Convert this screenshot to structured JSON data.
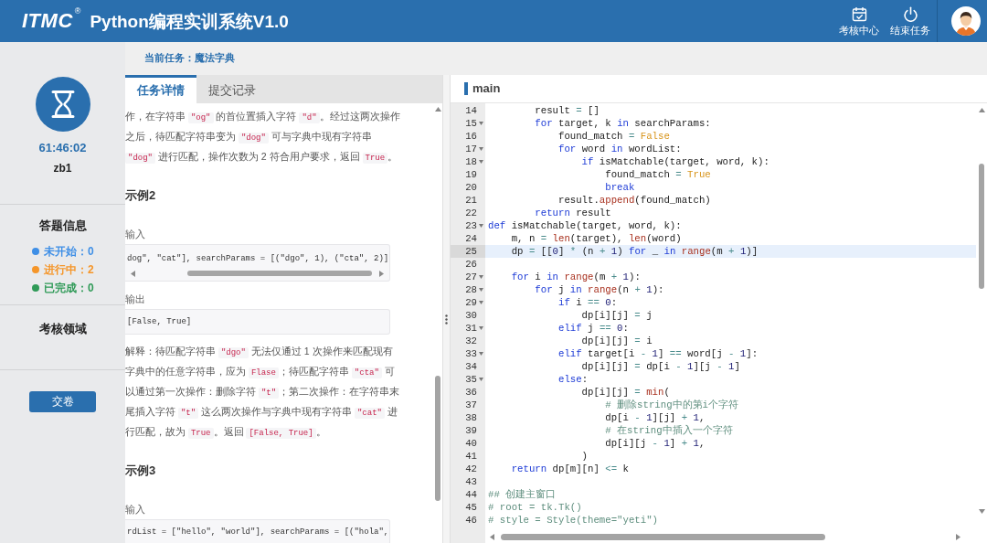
{
  "header": {
    "logo": "ITMC",
    "logo_mark": "®",
    "title": "Python编程实训系统V1.0",
    "actions": [
      {
        "kind": "calendar",
        "label": "考核中心"
      },
      {
        "kind": "power",
        "label": "结束任务"
      }
    ]
  },
  "sidebar": {
    "timer": "61:46:02",
    "user": "zb1",
    "info_title": "答题信息",
    "statuses": [
      {
        "text": "未开始：0",
        "color": "#3f8fe6"
      },
      {
        "text": "进行中：2",
        "color": "#f5962a"
      },
      {
        "text": "已完成：0",
        "color": "#2f9a57"
      }
    ],
    "domain_title": "考核领域",
    "submit_button": "交卷"
  },
  "task_bar": {
    "text": "当前任务：魔法字典"
  },
  "task_panel": {
    "tabs": [
      {
        "label": "任务详情",
        "selected": true
      },
      {
        "label": "提交记录",
        "selected": false
      }
    ],
    "content": [
      {
        "kind": "paragraph",
        "lines": [
          [
            {
              "kind": "text",
              "text": "作，在字符串 "
            },
            {
              "kind": "code",
              "text": "\"og\""
            },
            {
              "kind": "text",
              "text": " 的首位置插入字符 "
            },
            {
              "kind": "code",
              "text": "\"d\""
            },
            {
              "kind": "text",
              "text": "。经过这两次操作"
            }
          ],
          [
            {
              "kind": "text",
              "text": "之后，待匹配字符串变为 "
            },
            {
              "kind": "code",
              "text": "\"dog\""
            },
            {
              "kind": "text",
              "text": " 可与字典中现有字符串"
            }
          ],
          [
            {
              "kind": "code",
              "text": "\"dog\""
            },
            {
              "kind": "text",
              "text": " 进行匹配，操作次数为 2 符合用户要求，返回 "
            },
            {
              "kind": "code",
              "text": "True"
            },
            {
              "kind": "text",
              "text": "。"
            }
          ]
        ]
      },
      {
        "kind": "heading",
        "text": "示例2"
      },
      {
        "kind": "label",
        "text": "输入"
      },
      {
        "kind": "code",
        "text": "dog\", \"cat\"], searchParams = [(\"dgo\", 1), (\"cta\", 2)]",
        "scrollbar": true
      },
      {
        "kind": "label",
        "text": "输出"
      },
      {
        "kind": "code",
        "text": "[False, True]",
        "scrollbar": false
      },
      {
        "kind": "paragraph",
        "lines": [
          [
            {
              "kind": "text",
              "text": "解释：待匹配字符串 "
            },
            {
              "kind": "code",
              "text": "\"dgo\""
            },
            {
              "kind": "text",
              "text": " 无法仅通过 1 次操作来匹配现有"
            }
          ],
          [
            {
              "kind": "text",
              "text": "字典中的任意字符串，应为 "
            },
            {
              "kind": "code",
              "text": "Flase"
            },
            {
              "kind": "text",
              "text": "；待匹配字符串 "
            },
            {
              "kind": "code",
              "text": "\"cta\""
            },
            {
              "kind": "text",
              "text": " 可"
            }
          ],
          [
            {
              "kind": "text",
              "text": "以通过第一次操作：删除字符 "
            },
            {
              "kind": "code",
              "text": "\"t\""
            },
            {
              "kind": "text",
              "text": "；第二次操作：在字符串末"
            }
          ],
          [
            {
              "kind": "text",
              "text": "尾插入字符 "
            },
            {
              "kind": "code",
              "text": "\"t\""
            },
            {
              "kind": "text",
              "text": " 这么两次操作与字典中现有字符串 "
            },
            {
              "kind": "code",
              "text": "\"cat\""
            },
            {
              "kind": "text",
              "text": " 进"
            }
          ],
          [
            {
              "kind": "text",
              "text": "行匹配，故为 "
            },
            {
              "kind": "code",
              "text": "True"
            },
            {
              "kind": "text",
              "text": "。返回 "
            },
            {
              "kind": "code",
              "text": "[False, True]"
            },
            {
              "kind": "text",
              "text": "。"
            }
          ]
        ]
      },
      {
        "kind": "heading",
        "text": "示例3"
      },
      {
        "kind": "label",
        "text": "输入"
      },
      {
        "kind": "code",
        "text": "rdList = [\"hello\", \"world\"], searchParams = [(\"hola\",",
        "scrollbar": false
      }
    ]
  },
  "editor": {
    "file": "main",
    "lines": [
      {
        "number": "14",
        "foldable": false,
        "active": false,
        "tokens": [
          {
            "kind": "plain",
            "text": "        result "
          },
          {
            "kind": "operator",
            "text": "="
          },
          {
            "kind": "plain",
            "text": " []"
          }
        ]
      },
      {
        "number": "15",
        "foldable": true,
        "active": false,
        "tokens": [
          {
            "kind": "keyword",
            "text": "        for"
          },
          {
            "kind": "plain",
            "text": " target, k "
          },
          {
            "kind": "keyword",
            "text": "in"
          },
          {
            "kind": "plain",
            "text": " searchParams:"
          }
        ]
      },
      {
        "number": "16",
        "foldable": false,
        "active": false,
        "tokens": [
          {
            "kind": "plain",
            "text": "            found_match "
          },
          {
            "kind": "operator",
            "text": "="
          },
          {
            "kind": "constant",
            "text": " False"
          }
        ]
      },
      {
        "number": "17",
        "foldable": true,
        "active": false,
        "tokens": [
          {
            "kind": "keyword",
            "text": "            for"
          },
          {
            "kind": "plain",
            "text": " word "
          },
          {
            "kind": "keyword",
            "text": "in"
          },
          {
            "kind": "plain",
            "text": " wordList:"
          }
        ]
      },
      {
        "number": "18",
        "foldable": true,
        "active": false,
        "tokens": [
          {
            "kind": "keyword",
            "text": "                if"
          },
          {
            "kind": "plain",
            "text": " isMatchable(target, word, k):"
          }
        ]
      },
      {
        "number": "19",
        "foldable": false,
        "active": false,
        "tokens": [
          {
            "kind": "plain",
            "text": "                    found_match "
          },
          {
            "kind": "operator",
            "text": "="
          },
          {
            "kind": "constant",
            "text": " True"
          }
        ]
      },
      {
        "number": "20",
        "foldable": false,
        "active": false,
        "tokens": [
          {
            "kind": "keyword",
            "text": "                    break"
          }
        ]
      },
      {
        "number": "21",
        "foldable": false,
        "active": false,
        "tokens": [
          {
            "kind": "plain",
            "text": "            result."
          },
          {
            "kind": "builtin",
            "text": "append"
          },
          {
            "kind": "plain",
            "text": "(found_match)"
          }
        ]
      },
      {
        "number": "22",
        "foldable": false,
        "active": false,
        "tokens": [
          {
            "kind": "keyword",
            "text": "        return"
          },
          {
            "kind": "plain",
            "text": " result"
          }
        ]
      },
      {
        "number": "23",
        "foldable": true,
        "active": false,
        "tokens": [
          {
            "kind": "keyword",
            "text": "def"
          },
          {
            "kind": "plain",
            "text": " isMatchable(target, word, k):"
          }
        ]
      },
      {
        "number": "24",
        "foldable": false,
        "active": false,
        "tokens": [
          {
            "kind": "plain",
            "text": "    m, n "
          },
          {
            "kind": "operator",
            "text": "="
          },
          {
            "kind": "builtin",
            "text": " len"
          },
          {
            "kind": "plain",
            "text": "(target), "
          },
          {
            "kind": "builtin",
            "text": "len"
          },
          {
            "kind": "plain",
            "text": "(word)"
          }
        ]
      },
      {
        "number": "25",
        "foldable": false,
        "active": true,
        "tokens": [
          {
            "kind": "plain",
            "text": "    dp "
          },
          {
            "kind": "operator",
            "text": "="
          },
          {
            "kind": "plain",
            "text": " [["
          },
          {
            "kind": "number",
            "text": "0"
          },
          {
            "kind": "plain",
            "text": "] "
          },
          {
            "kind": "operator",
            "text": "*"
          },
          {
            "kind": "plain",
            "text": " (n "
          },
          {
            "kind": "operator",
            "text": "+"
          },
          {
            "kind": "number",
            "text": " 1"
          },
          {
            "kind": "plain",
            "text": ") "
          },
          {
            "kind": "keyword",
            "text": "for"
          },
          {
            "kind": "plain",
            "text": " _ "
          },
          {
            "kind": "keyword",
            "text": "in"
          },
          {
            "kind": "builtin",
            "text": " range"
          },
          {
            "kind": "plain",
            "text": "(m "
          },
          {
            "kind": "operator",
            "text": "+"
          },
          {
            "kind": "number",
            "text": " 1"
          },
          {
            "kind": "plain",
            "text": ")]"
          }
        ]
      },
      {
        "number": "26",
        "foldable": false,
        "active": false
      },
      {
        "number": "27",
        "foldable": true,
        "active": false,
        "tokens": [
          {
            "kind": "keyword",
            "text": "    for"
          },
          {
            "kind": "plain",
            "text": " i "
          },
          {
            "kind": "keyword",
            "text": "in"
          },
          {
            "kind": "builtin",
            "text": " range"
          },
          {
            "kind": "plain",
            "text": "(m "
          },
          {
            "kind": "operator",
            "text": "+"
          },
          {
            "kind": "number",
            "text": " 1"
          },
          {
            "kind": "plain",
            "text": "):"
          }
        ]
      },
      {
        "number": "28",
        "foldable": true,
        "active": false,
        "tokens": [
          {
            "kind": "keyword",
            "text": "        for"
          },
          {
            "kind": "plain",
            "text": " j "
          },
          {
            "kind": "keyword",
            "text": "in"
          },
          {
            "kind": "builtin",
            "text": " range"
          },
          {
            "kind": "plain",
            "text": "(n "
          },
          {
            "kind": "operator",
            "text": "+"
          },
          {
            "kind": "number",
            "text": " 1"
          },
          {
            "kind": "plain",
            "text": "):"
          }
        ]
      },
      {
        "number": "29",
        "foldable": true,
        "active": false,
        "tokens": [
          {
            "kind": "keyword",
            "text": "            if"
          },
          {
            "kind": "plain",
            "text": " i "
          },
          {
            "kind": "operator",
            "text": "=="
          },
          {
            "kind": "number",
            "text": " 0"
          },
          {
            "kind": "plain",
            "text": ":"
          }
        ]
      },
      {
        "number": "30",
        "foldable": false,
        "active": false,
        "tokens": [
          {
            "kind": "plain",
            "text": "                dp[i][j] "
          },
          {
            "kind": "operator",
            "text": "="
          },
          {
            "kind": "plain",
            "text": " j"
          }
        ]
      },
      {
        "number": "31",
        "foldable": true,
        "active": false,
        "tokens": [
          {
            "kind": "keyword",
            "text": "            elif"
          },
          {
            "kind": "plain",
            "text": " j "
          },
          {
            "kind": "operator",
            "text": "=="
          },
          {
            "kind": "number",
            "text": " 0"
          },
          {
            "kind": "plain",
            "text": ":"
          }
        ]
      },
      {
        "number": "32",
        "foldable": false,
        "active": false,
        "tokens": [
          {
            "kind": "plain",
            "text": "                dp[i][j] "
          },
          {
            "kind": "operator",
            "text": "="
          },
          {
            "kind": "plain",
            "text": " i"
          }
        ]
      },
      {
        "number": "33",
        "foldable": true,
        "active": false,
        "tokens": [
          {
            "kind": "keyword",
            "text": "            elif"
          },
          {
            "kind": "plain",
            "text": " target[i "
          },
          {
            "kind": "operator",
            "text": "-"
          },
          {
            "kind": "number",
            "text": " 1"
          },
          {
            "kind": "plain",
            "text": "] "
          },
          {
            "kind": "operator",
            "text": "=="
          },
          {
            "kind": "plain",
            "text": " word[j "
          },
          {
            "kind": "operator",
            "text": "-"
          },
          {
            "kind": "number",
            "text": " 1"
          },
          {
            "kind": "plain",
            "text": "]:"
          }
        ]
      },
      {
        "number": "34",
        "foldable": false,
        "active": false,
        "tokens": [
          {
            "kind": "plain",
            "text": "                dp[i][j] "
          },
          {
            "kind": "operator",
            "text": "="
          },
          {
            "kind": "plain",
            "text": " dp[i "
          },
          {
            "kind": "operator",
            "text": "-"
          },
          {
            "kind": "number",
            "text": " 1"
          },
          {
            "kind": "plain",
            "text": "][j "
          },
          {
            "kind": "operator",
            "text": "-"
          },
          {
            "kind": "number",
            "text": " 1"
          },
          {
            "kind": "plain",
            "text": "]"
          }
        ]
      },
      {
        "number": "35",
        "foldable": true,
        "active": false,
        "tokens": [
          {
            "kind": "keyword",
            "text": "            else"
          },
          {
            "kind": "plain",
            "text": ":"
          }
        ]
      },
      {
        "number": "36",
        "foldable": false,
        "active": false,
        "tokens": [
          {
            "kind": "plain",
            "text": "                dp[i][j] "
          },
          {
            "kind": "operator",
            "text": "="
          },
          {
            "kind": "builtin",
            "text": " min"
          },
          {
            "kind": "plain",
            "text": "("
          }
        ]
      },
      {
        "number": "37",
        "foldable": false,
        "active": false,
        "tokens": [
          {
            "kind": "comment",
            "text": "                    # 删除string中的第i个字符"
          }
        ]
      },
      {
        "number": "38",
        "foldable": false,
        "active": false,
        "tokens": [
          {
            "kind": "plain",
            "text": "                    dp[i "
          },
          {
            "kind": "operator",
            "text": "-"
          },
          {
            "kind": "number",
            "text": " 1"
          },
          {
            "kind": "plain",
            "text": "][j] "
          },
          {
            "kind": "operator",
            "text": "+"
          },
          {
            "kind": "number",
            "text": " 1"
          },
          {
            "kind": "plain",
            "text": ","
          }
        ]
      },
      {
        "number": "39",
        "foldable": false,
        "active": false,
        "tokens": [
          {
            "kind": "comment",
            "text": "                    # 在string中插入一个字符"
          }
        ]
      },
      {
        "number": "40",
        "foldable": false,
        "active": false,
        "tokens": [
          {
            "kind": "plain",
            "text": "                    dp[i][j "
          },
          {
            "kind": "operator",
            "text": "-"
          },
          {
            "kind": "number",
            "text": " 1"
          },
          {
            "kind": "plain",
            "text": "] "
          },
          {
            "kind": "operator",
            "text": "+"
          },
          {
            "kind": "number",
            "text": " 1"
          },
          {
            "kind": "plain",
            "text": ","
          }
        ]
      },
      {
        "number": "41",
        "foldable": false,
        "active": false,
        "tokens": [
          {
            "kind": "plain",
            "text": "                )"
          }
        ]
      },
      {
        "number": "42",
        "foldable": false,
        "active": false,
        "tokens": [
          {
            "kind": "keyword",
            "text": "    return"
          },
          {
            "kind": "plain",
            "text": " dp[m][n] "
          },
          {
            "kind": "operator",
            "text": "<="
          },
          {
            "kind": "plain",
            "text": " k"
          }
        ]
      },
      {
        "number": "43",
        "foldable": false,
        "active": false
      },
      {
        "number": "44",
        "foldable": false,
        "active": false,
        "tokens": [
          {
            "kind": "comment",
            "text": "## 创建主窗口"
          }
        ]
      },
      {
        "number": "45",
        "foldable": false,
        "active": false,
        "tokens": [
          {
            "kind": "comment",
            "text": "# root = tk.Tk()"
          }
        ]
      },
      {
        "number": "46",
        "foldable": false,
        "active": false,
        "tokens": [
          {
            "kind": "comment",
            "text": "# style = Style(theme=\"yeti\")"
          }
        ]
      }
    ]
  }
}
